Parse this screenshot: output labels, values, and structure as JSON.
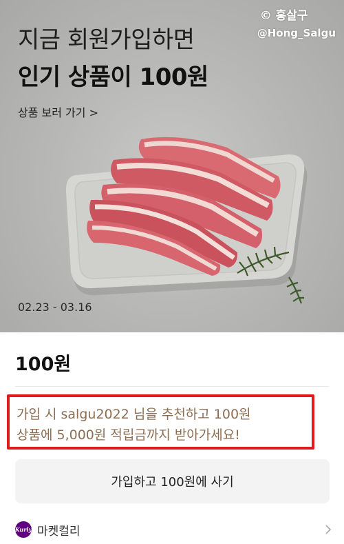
{
  "banner": {
    "headline_line1": "지금 회원가입하면",
    "headline_line2": "인기 상품이 100원",
    "see_products_link": "상품 보러 가기 >",
    "date_range": "02.23 - 03.16",
    "watermark_line1": "© 홍살구",
    "watermark_line2": "@Hong_Salgu"
  },
  "product": {
    "price": "100원"
  },
  "promo": {
    "line1": "가입 시 salgu2022 님을 추천하고 100원",
    "line2": "상품에 5,000원 적립금까지  받아가세요!",
    "highlight_color": "#e01b1b"
  },
  "actions": {
    "buy_button_label": "가입하고 100원에 사기"
  },
  "store": {
    "logo_text": "Kurly",
    "name": "마켓컬리",
    "brand_color": "#5f0080",
    "arrow_icon": "chevron-right-icon"
  }
}
